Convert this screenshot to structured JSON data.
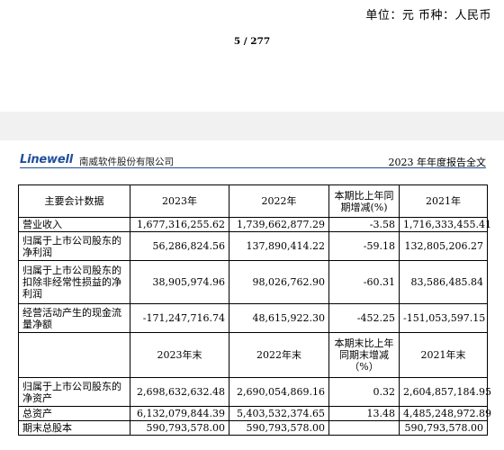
{
  "top": {
    "unit_text": "单位：元   币种：人民币",
    "page_number": "5 / 277"
  },
  "header": {
    "logo": "Linewell",
    "company_name": "南威软件股份有限公司",
    "report_title": "2023 年年度报告全文"
  },
  "table": {
    "headers1": [
      "主要会计数据",
      "2023年",
      "2022年",
      "本期比上年同期增减(%)",
      "2021年"
    ],
    "rows1": [
      [
        "营业收入",
        "1,677,316,255.62",
        "1,739,662,877.29",
        "-3.58",
        "1,716,333,455.41"
      ],
      [
        "归属于上市公司股东的净利润",
        "56,286,824.56",
        "137,890,414.22",
        "-59.18",
        "132,805,206.27"
      ],
      [
        "归属于上市公司股东的扣除非经常性损益的净利润",
        "38,905,974.96",
        "98,026,762.90",
        "-60.31",
        "83,586,485.84"
      ],
      [
        "经营活动产生的现金流量净额",
        "-171,247,716.74",
        "48,615,922.30",
        "-452.25",
        "-151,053,597.15"
      ]
    ],
    "headers2": [
      "",
      "2023年末",
      "2022年末",
      "本期末比上年同期末增减（%）",
      "2021年末"
    ],
    "rows2": [
      [
        "归属于上市公司股东的净资产",
        "2,698,632,632.48",
        "2,690,054,869.16",
        "0.32",
        "2,604,857,184.95"
      ],
      [
        "总资产",
        "6,132,079,844.39",
        "5,403,532,374.65",
        "13.48",
        "4,485,248,972.89"
      ],
      [
        "期末总股本",
        "590,793,578.00",
        "590,793,578.00",
        "",
        "590,793,578.00"
      ]
    ]
  }
}
